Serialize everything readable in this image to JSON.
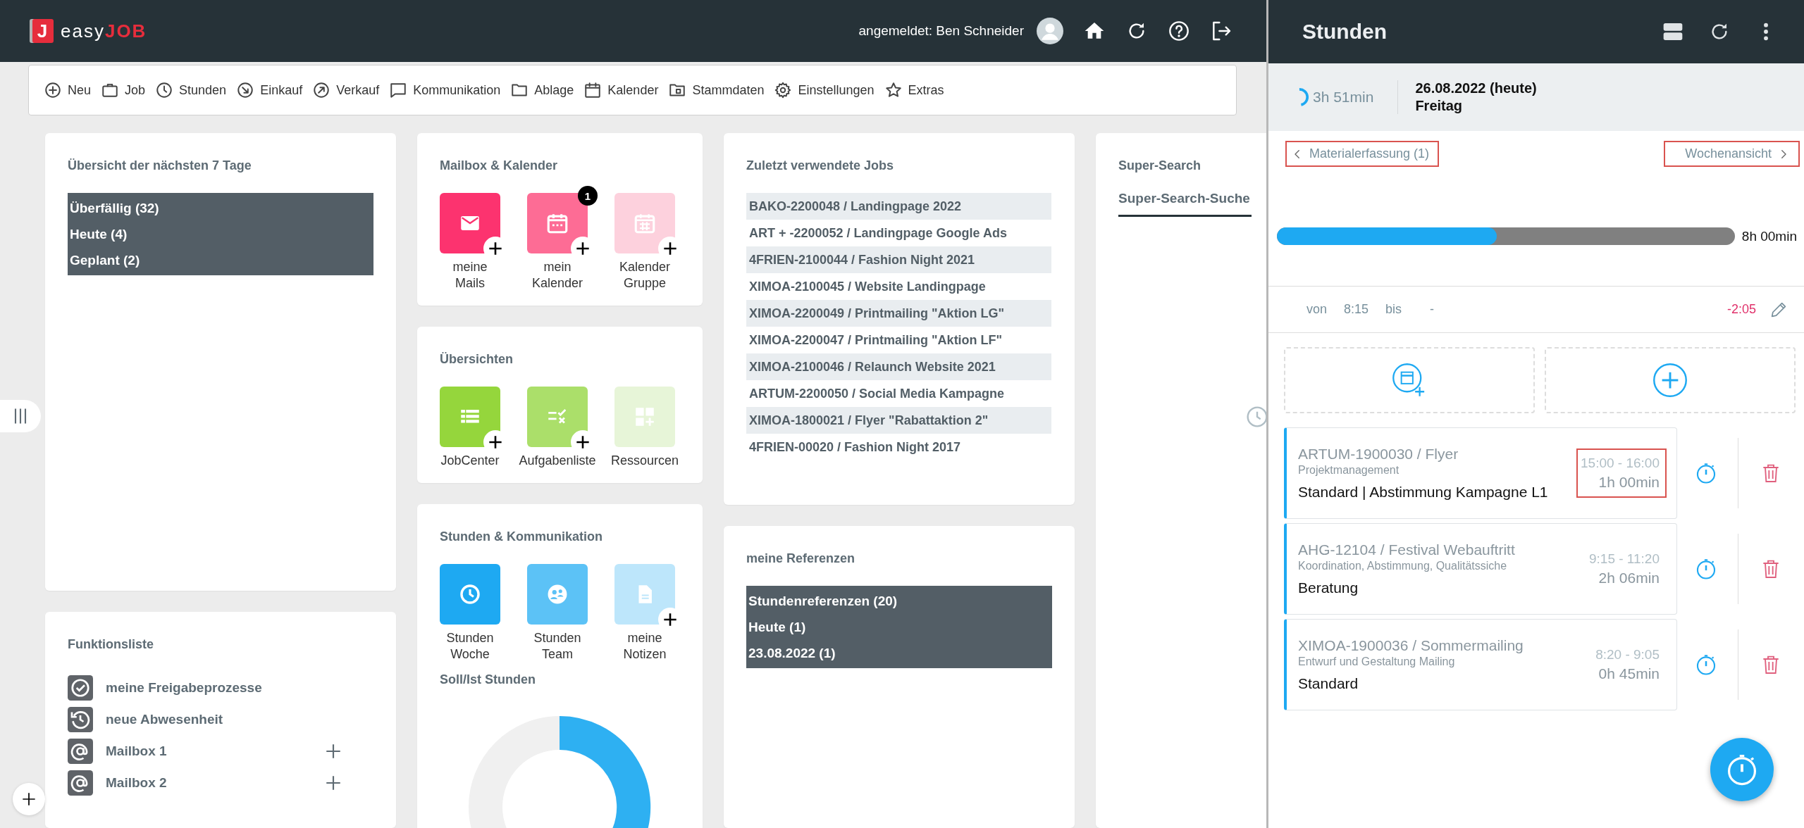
{
  "header": {
    "logo": {
      "mark": "J",
      "word": "easy",
      "accent": "JOB"
    },
    "user_label": "angemeldet: Ben Schneider"
  },
  "toolbar": [
    "Neu",
    "Job",
    "Stunden",
    "Einkauf",
    "Verkauf",
    "Kommunikation",
    "Ablage",
    "Kalender",
    "Stammdaten",
    "Einstellungen",
    "Extras"
  ],
  "overview_card": {
    "title": "Übersicht der nächsten 7 Tage",
    "items": [
      "Überfällig (32)",
      "Heute (4)",
      "Geplant (2)"
    ]
  },
  "function_list": {
    "title": "Funktionsliste",
    "items": [
      {
        "label": "meine Freigabeprozesse",
        "addable": false
      },
      {
        "label": "neue Abwesenheit",
        "addable": false
      },
      {
        "label": "Mailbox 1",
        "addable": true
      },
      {
        "label": "Mailbox 2",
        "addable": true
      }
    ]
  },
  "mailbox_calendar": {
    "title": "Mailbox & Kalender",
    "tiles": [
      {
        "label": "meine Mails",
        "color": "#fc336f",
        "addable": true
      },
      {
        "label": "mein Kalender",
        "color": "#fd6c95",
        "addable": true,
        "badge": "1"
      },
      {
        "label": "Kalender Gruppe",
        "color": "#fdd1dd",
        "addable": true
      }
    ]
  },
  "overviews": {
    "title": "Übersichten",
    "tiles": [
      {
        "label": "JobCenter",
        "color": "#95d63c",
        "addable": true
      },
      {
        "label": "Aufgabenliste",
        "color": "#abdf6a",
        "addable": true
      },
      {
        "label": "Ressourcen",
        "color": "#e7f5d8",
        "addable": false
      }
    ]
  },
  "hours_communication": {
    "title": "Stunden & Kommunikation",
    "tiles": [
      {
        "label": "Stunden Woche",
        "color": "#1ea9f2",
        "addable": false
      },
      {
        "label": "Stunden Team",
        "color": "#5cc2f6",
        "addable": false
      },
      {
        "label": "meine Notizen",
        "color": "#bde6fb",
        "addable": true
      }
    ],
    "subtitle": "Soll/Ist Stunden"
  },
  "recent_jobs": {
    "title": "Zuletzt verwendete Jobs",
    "items": [
      "BAKO-2200048 / Landingpage 2022",
      "ART + -2200052 / Landingpage Google Ads",
      "4FRIEN-2100044 / Fashion Night 2021",
      "XIMOA-2100045 / Website Landingpage",
      "XIMOA-2200049 / Printmailing \"Aktion LG\"",
      "XIMOA-2200047 / Printmailing \"Aktion LF\"",
      "XIMOA-2100046 / Relaunch Website 2021",
      "ARTUM-2200050 / Social Media Kampagne",
      "XIMOA-1800021 / Flyer \"Rabattaktion 2\"",
      "4FRIEN-00020 / Fashion Night 2017"
    ]
  },
  "references": {
    "title": "meine Referenzen",
    "items": [
      "Stundenreferenzen (20)",
      "Heute (1)",
      "23.08.2022 (1)"
    ]
  },
  "super_search": {
    "title": "Super-Search",
    "tabs": [
      {
        "label": "Super-Search-Suche",
        "selected": true
      }
    ]
  },
  "hours_panel": {
    "title": "Stunden",
    "summary": {
      "total": "3h 51min",
      "date": "26.08.2022 (heute)",
      "weekday": "Freitag"
    },
    "nav": [
      {
        "label": "Materialerfassung (1)",
        "back": true,
        "highlighted": true
      },
      {
        "label": "Wochenansicht",
        "back": false,
        "highlighted": true
      }
    ],
    "progress": {
      "level": 0.48,
      "reading": "8h 00min"
    },
    "time_row": {
      "from_label": "von",
      "from": "8:15",
      "to_label": "bis",
      "to": "-",
      "balance": "-2:05"
    },
    "entries": [
      {
        "job": "ARTUM-1900030 / Flyer",
        "activity": "Projektmanagement",
        "description": "Standard | Abstimmung Kampagne L1",
        "range": "15:00 - 16:00",
        "duration": "1h 00min",
        "highlighted": true
      },
      {
        "job": "AHG-12104 / Festival Webauftritt",
        "activity": "Koordination, Abstimmung, Qualitätssiche",
        "description": "Beratung",
        "range": "9:15 - 11:20",
        "duration": "2h 06min",
        "highlighted": false
      },
      {
        "job": "XIMOA-1900036 / Sommermailing",
        "activity": "Entwurf und Gestaltung Mailing",
        "description": "Standard",
        "range": "8:20 - 9:05",
        "duration": "0h 45min",
        "highlighted": false
      }
    ]
  }
}
